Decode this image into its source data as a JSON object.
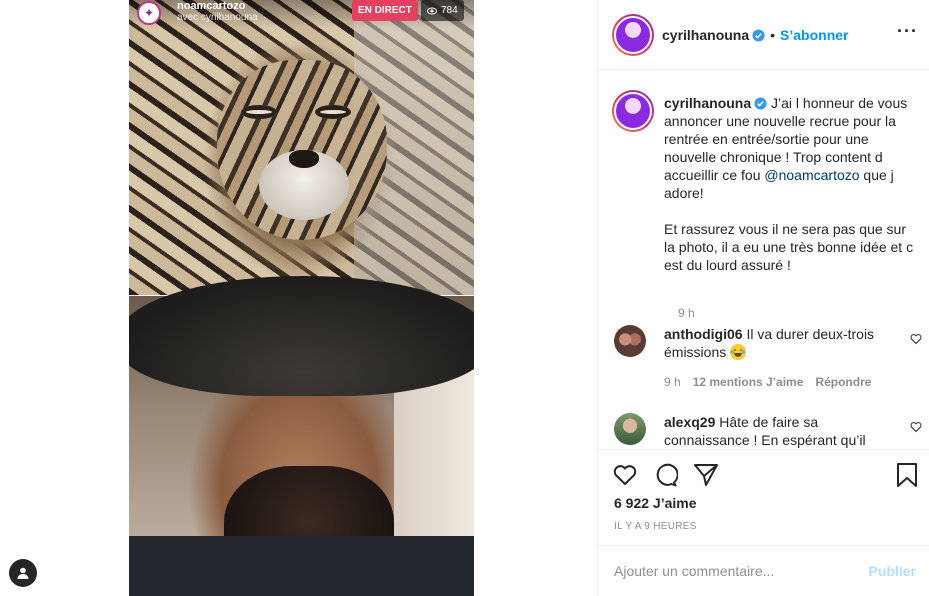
{
  "live": {
    "username": "noamcartozo",
    "with_text": "avec cyrilhanouna",
    "badge": "EN DIRECT",
    "viewers": "784"
  },
  "header": {
    "username": "cyrilhanouna",
    "separator": "•",
    "follow_label": "S’abonner",
    "more_label": "···"
  },
  "caption": {
    "username": "cyrilhanouna",
    "text_before_mention": " J’ai l honneur de vous annoncer une nouvelle recrue pour la rentrée en entrée/sortie pour une nouvelle chronique ! Trop content d accueillir ce fou ",
    "mention": "@noamcartozo",
    "text_after_mention": " que j adore!\n\nEt rassurez vous il ne sera pas que sur la photo, il a eu une très bonne idée et c est du lourd assuré !",
    "time": "9 h"
  },
  "comments": [
    {
      "username": "anthodigi06",
      "text": " Il va durer deux-trois émissions ",
      "emoji": "tears-of-joy-emoji",
      "time": "9 h",
      "likes": "12 mentions J’aime",
      "reply": "Répondre"
    },
    {
      "username": "alexq29",
      "text": " Hâte de faire sa connaissance ! En espérant qu’il"
    }
  ],
  "actions": {
    "likes": "6 922 J’aime",
    "posted_ago": "IL Y A 9 HEURES"
  },
  "add_comment": {
    "placeholder": "Ajouter un commentaire...",
    "publish_label": "Publier"
  },
  "colors": {
    "accent": "#0095f6",
    "live_red": "#e4405f",
    "publish_disabled": "#b2dffc",
    "muted": "#8e8e8e",
    "mention": "#00376b"
  }
}
